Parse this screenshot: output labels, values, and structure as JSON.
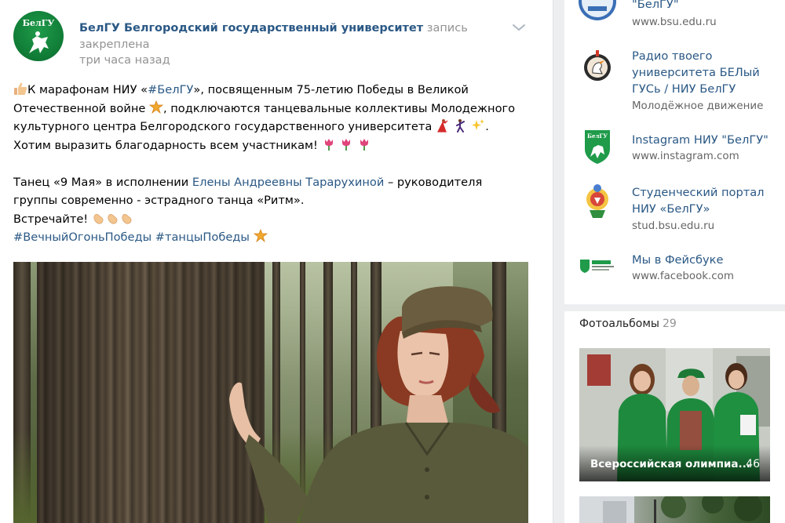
{
  "post": {
    "author": "БелГУ Белгородский государственный университет",
    "pinned_label": "запись закреплена",
    "time": "три часа назад",
    "avatar_text": "БелГУ",
    "lines": {
      "l1_a": "К марафонам НИУ «",
      "l1_tag": "#БелГУ",
      "l1_b": "», посвященным 75-летию Победы в Великой",
      "l2_a": "Отечественной войне",
      "l2_b": ", подключаются танцевальные коллективы Молодежного",
      "l3": "культурного центра Белгородского государственного университета",
      "l4": "Хотим выразить благодарность всем участникам!",
      "l5_a": "Танец «9 Мая» в исполнении",
      "l5_link": "Елены Андреевны Тарарухиной",
      "l5_b": " – руководителя",
      "l6": "группы современно - эстрадного танца «Ритм».",
      "l7": "Встречайте!",
      "tag1": "#ВечныйОгоньПобеды",
      "tag2": "#танцыПобеды"
    },
    "icons": [
      "thumbs-up-icon",
      "chevron-down-icon",
      "victory-star-icon",
      "dancer-icon",
      "sparkles-icon",
      "tulip-icon",
      "clapping-hands-icon"
    ]
  },
  "links": [
    {
      "title": "\"БелГУ\"",
      "url": "www.bsu.edu.ru",
      "icon": "bsu-logo-icon"
    },
    {
      "title": "Радио твоего университета БЕЛый ГУСь / НИУ БелГУ",
      "url": "Молодёжное движение",
      "icon": "radio-goose-icon"
    },
    {
      "title": "Instagram НИУ \"БелГУ\"",
      "url": "www.instagram.com",
      "icon": "bsu-shield-icon"
    },
    {
      "title": "Студенческий портал НИУ «БелГУ»",
      "url": "stud.bsu.edu.ru",
      "icon": "student-portal-icon"
    },
    {
      "title": "Мы в Фейсбуке",
      "url": "www.facebook.com",
      "icon": "facebook-bsu-icon"
    }
  ],
  "albums": {
    "header": "Фотоальбомы",
    "count": "29",
    "items": [
      {
        "title": "Всероссийская олимпиа...",
        "count": "46"
      }
    ]
  },
  "colors": {
    "link": "#2a5885",
    "muted": "#939393",
    "brand_green": "#1f9b4a",
    "page_bg": "#edeef0"
  }
}
